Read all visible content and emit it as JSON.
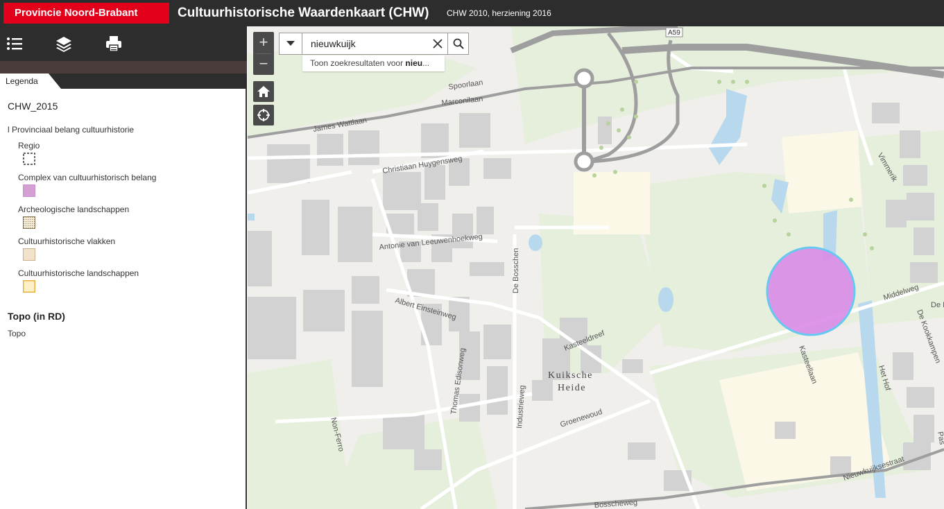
{
  "header": {
    "brand": "Provincie Noord-Brabant",
    "title": "Cultuurhistorische Waardenkaart (CHW)",
    "subtitle": "CHW 2010, herziening 2016"
  },
  "toolbar": {
    "icons": [
      "list-icon",
      "layers-icon",
      "print-icon"
    ]
  },
  "legend": {
    "tab_label": "Legenda",
    "layer_title": "CHW_2015",
    "group_label": "l Provinciaal belang cultuurhistorie",
    "items": [
      {
        "label": "Regio",
        "fill": "#ffffff",
        "stroke": "#333333",
        "dashed": true
      },
      {
        "label": "Complex van cultuurhistorisch belang",
        "fill": "#d4a0d4",
        "stroke": "#c890c8",
        "dashed": false
      },
      {
        "label": "Archeologische landschappen",
        "fill": "#f4ecd8",
        "stroke": "#8a7a5a",
        "dashed": false
      },
      {
        "label": "Cultuurhistorische vlakken",
        "fill": "#f2e2cc",
        "stroke": "#c9b08a",
        "dashed": false
      },
      {
        "label": "Cultuurhistorische landschappen",
        "fill": "#fbf0c8",
        "stroke": "#e8b040",
        "dashed": false
      }
    ],
    "topo_title": "Topo (in RD)",
    "topo_item": "Topo"
  },
  "search": {
    "value": "nieuwkuijk",
    "suggestion_prefix": "Toon zoekresultaten voor ",
    "suggestion_bold": "nieu",
    "suggestion_suffix": "..."
  },
  "map": {
    "zoom_in": "+",
    "zoom_out": "−",
    "highlight_color": "#d98be8",
    "labels": {
      "a59": "A59",
      "spoorlaan": "Spoorlaan",
      "marconilaan": "Marconilaan",
      "james_wattlaan": "James Wattlaan",
      "huygensweg": "Christiaan Huygensweg",
      "leeuwenhoekweg": "Antonie van Leeuwenhoekweg",
      "de_bosschen": "De Bosschen",
      "einsteinweg": "Albert Einsteinweg",
      "edisonweg": "Thomas Edisonweg",
      "industrieweg": "Industrieweg",
      "kuiksche": "Kuiksche",
      "heide": "Heide",
      "kasteeldreef": "Kasteeldreef",
      "groenewoud": "Groenewoud",
      "non_ferro": "Non-Ferro",
      "bosscheweg": "Bosscheweg",
      "vimmerik": "Vimmerik",
      "middelweg": "Middelweg",
      "kasteellaan": "Kasteellaan",
      "de_kookkampen": "De Kookkampen",
      "het_hof": "Het Hof",
      "nieuwkuijksestraat": "Nieuwkuijksestraat",
      "de_m": "De M",
      "pas": "Pas"
    }
  }
}
